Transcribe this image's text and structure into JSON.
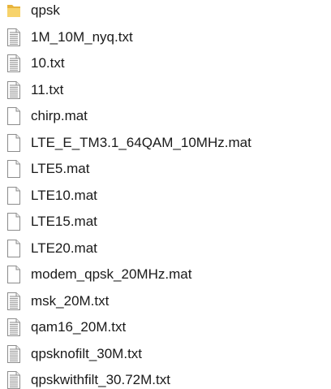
{
  "files": [
    {
      "name": "qpsk",
      "icon": "folder-icon",
      "kind": "folder"
    },
    {
      "name": "1M_10M_nyq.txt",
      "icon": "text-file-icon",
      "kind": "txt"
    },
    {
      "name": "10.txt",
      "icon": "text-file-icon",
      "kind": "txt"
    },
    {
      "name": "11.txt",
      "icon": "text-file-icon",
      "kind": "txt"
    },
    {
      "name": "chirp.mat",
      "icon": "blank-file-icon",
      "kind": "mat"
    },
    {
      "name": "LTE_E_TM3.1_64QAM_10MHz.mat",
      "icon": "blank-file-icon",
      "kind": "mat"
    },
    {
      "name": "LTE5.mat",
      "icon": "blank-file-icon",
      "kind": "mat"
    },
    {
      "name": "LTE10.mat",
      "icon": "blank-file-icon",
      "kind": "mat"
    },
    {
      "name": "LTE15.mat",
      "icon": "blank-file-icon",
      "kind": "mat"
    },
    {
      "name": "LTE20.mat",
      "icon": "blank-file-icon",
      "kind": "mat"
    },
    {
      "name": "modem_qpsk_20MHz.mat",
      "icon": "blank-file-icon",
      "kind": "mat"
    },
    {
      "name": "msk_20M.txt",
      "icon": "text-file-icon",
      "kind": "txt"
    },
    {
      "name": "qam16_20M.txt",
      "icon": "text-file-icon",
      "kind": "txt"
    },
    {
      "name": "qpsknofilt_30M.txt",
      "icon": "text-file-icon",
      "kind": "txt"
    },
    {
      "name": "qpskwithfilt_30.72M.txt",
      "icon": "text-file-icon",
      "kind": "txt"
    }
  ]
}
